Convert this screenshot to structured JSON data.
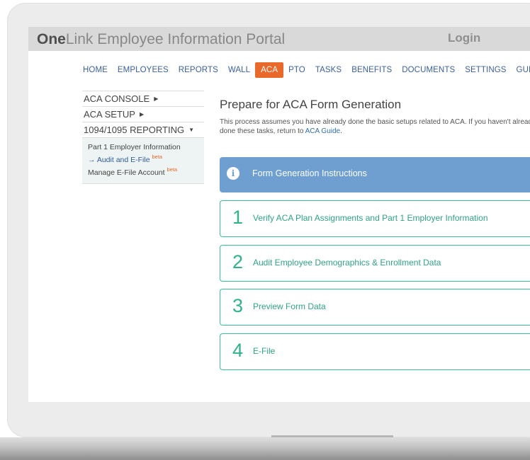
{
  "portal": {
    "brand_bold": "One",
    "brand_rest": "Link Employee Information Portal",
    "login_label": "Login"
  },
  "topnav": {
    "items": [
      "HOME",
      "EMPLOYEES",
      "REPORTS",
      "WALL",
      "ACA",
      "PTO",
      "TASKS",
      "BENEFITS",
      "DOCUMENTS",
      "SETTINGS",
      "GUIDE"
    ],
    "active": "ACA"
  },
  "leftnav": {
    "sections": [
      {
        "label": "ACA CONSOLE",
        "arrow": "▶"
      },
      {
        "label": "ACA SETUP",
        "arrow": "▶"
      },
      {
        "label": "1094/1095 REPORTING",
        "arrow": "▼"
      }
    ],
    "subitems": [
      {
        "label": "Part 1 Employer Information",
        "badge": ""
      },
      {
        "arrow": "→",
        "label": "Audit and E-File",
        "badge": "beta"
      },
      {
        "label": "Manage E-File Account",
        "badge": "beta"
      }
    ]
  },
  "main": {
    "title": "Prepare for ACA Form Generation",
    "intro_line1": "This process assumes you have already done the basic setups related to ACA. If you haven't already",
    "intro_line2_prefix": "done these tasks, return to ",
    "intro_link": "ACA Guide",
    "intro_suffix": ".",
    "instructions": {
      "icon": "i",
      "label": "Form Generation Instructions"
    },
    "steps": [
      {
        "number": "1",
        "label": "Verify ACA Plan Assignments and Part 1 Employer Information"
      },
      {
        "number": "2",
        "label": "Audit Employee Demographics & Enrollment Data"
      },
      {
        "number": "3",
        "label": "Preview Form Data"
      },
      {
        "number": "4",
        "label": "E-File"
      }
    ]
  },
  "colors": {
    "accent_orange": "#e8692a",
    "link_blue": "#2f6fb0",
    "instructions_blue": "#6f9fd1",
    "step_green": "#2fb38c"
  }
}
